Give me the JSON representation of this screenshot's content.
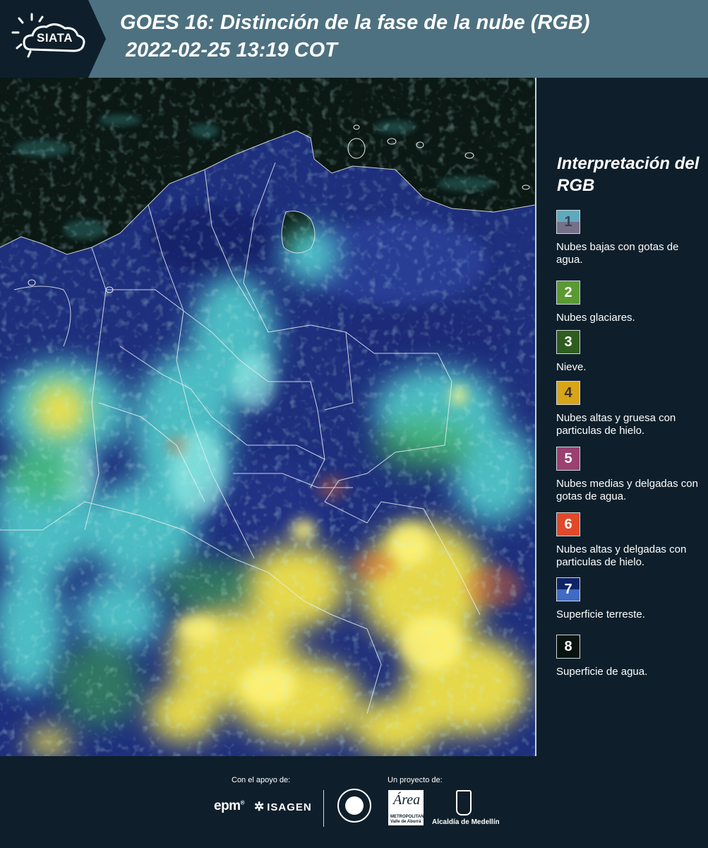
{
  "header": {
    "logo_text": "SIATA",
    "title_line1": "GOES 16: Distinción de la fase de la nube (RGB)",
    "title_line2": "2022-02-25 13:19 COT",
    "background": "#4d7180"
  },
  "map": {
    "description_icon": "satellite-map",
    "colors": {
      "water": "#0b1814",
      "land": "#1d2f7a",
      "low_water_clouds": "#5fe0d8",
      "thick_ice_clouds": "#f2e64a",
      "border": "#e8eef0"
    }
  },
  "legend": {
    "title": "Interpretación del RGB",
    "items": [
      {
        "number": "1",
        "label": "Nubes bajas con gotas de agua.",
        "top_color": "#5fa9bd",
        "bottom_color": "#76708a",
        "num_color": "#3a3f52"
      },
      {
        "number": "2",
        "label": "Nubes glaciares.",
        "top_color": "#5b9a32",
        "bottom_color": "#5b9a32",
        "num_color": "#ffffff"
      },
      {
        "number": "3",
        "label": "Nieve.",
        "top_color": "#2f5d1f",
        "bottom_color": "#2f5d1f",
        "num_color": "#ffffff"
      },
      {
        "number": "4",
        "label": "Nubes altas y gruesa con particulas de hielo.",
        "top_color": "#d8a418",
        "bottom_color": "#d8a418",
        "num_color": "#3a3030"
      },
      {
        "number": "5",
        "label": "Nubes medias y delgadas con gotas de agua.",
        "top_color": "#9a4170",
        "bottom_color": "#9a4170",
        "num_color": "#ffffff"
      },
      {
        "number": "6",
        "label": "Nubes altas y delgadas con particulas de hielo.",
        "top_color": "#e0492a",
        "bottom_color": "#e0492a",
        "num_color": "#ffffff"
      },
      {
        "number": "7",
        "label": "Superficie terreste.",
        "top_color": "#0f2466",
        "bottom_color": "#3e6bc4",
        "num_color": "#ffffff"
      },
      {
        "number": "8",
        "label": "Superficie de agua.",
        "top_color": "#081410",
        "bottom_color": "#081410",
        "num_color": "#ffffff"
      }
    ]
  },
  "footer": {
    "support_label": "Con el apoyo de:",
    "project_label": "Un proyecto de:",
    "sponsor1": "epm",
    "sponsor2": "ISAGEN",
    "partner_area": "Área",
    "partner_area_sub": "METROPOLITANA Valle de Aburrá",
    "partner_medellin": "Alcaldía de Medellín"
  }
}
